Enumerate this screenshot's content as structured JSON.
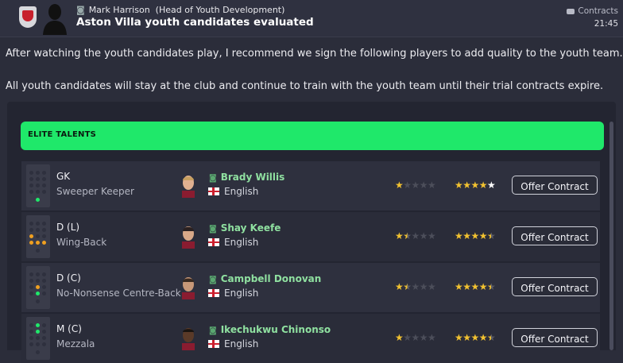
{
  "header": {
    "sender": "Mark Harrison",
    "sender_role": "(Head of Youth Development)",
    "title": "Aston Villa youth candidates evaluated",
    "category": "Contracts",
    "time": "21:45"
  },
  "body": {
    "paragraph1": "After watching the youth candidates play, I recommend we sign the following players to add quality to the youth team.",
    "paragraph2": "All youth candidates will stay at the club and continue to train with the youth team until their trial contracts expire."
  },
  "section": {
    "label": "ELITE TALENTS"
  },
  "candidates": [
    {
      "position": "GK",
      "role": "Sweeper Keeper",
      "name": "Brady Willis",
      "nationality": "English",
      "current_ability_stars": 1,
      "potential_ability_stars": 5,
      "offer_label": "Offer Contract"
    },
    {
      "position": "D (L)",
      "role": "Wing-Back",
      "name": "Shay Keefe",
      "nationality": "English",
      "current_ability_stars": 1.5,
      "potential_ability_stars": 4.5,
      "offer_label": "Offer Contract"
    },
    {
      "position": "D (C)",
      "role": "No-Nonsense Centre-Back",
      "name": "Campbell Donovan",
      "nationality": "English",
      "current_ability_stars": 1.5,
      "potential_ability_stars": 4.5,
      "offer_label": "Offer Contract"
    },
    {
      "position": "M (C)",
      "role": "Mezzala",
      "name": "Ikechukwu Chinonso",
      "nationality": "English",
      "current_ability_stars": 1,
      "potential_ability_stars": 4.5,
      "offer_label": "Offer Contract"
    }
  ],
  "colors": {
    "elite_green": "#1fe86a",
    "star_gold": "#f2c230",
    "name_green": "#8fe0a0"
  }
}
